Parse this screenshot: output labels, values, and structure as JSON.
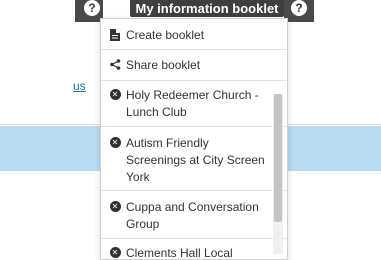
{
  "header": {
    "booklet_tab_label": "My information booklet",
    "help_left": "?",
    "help_right": "?"
  },
  "background": {
    "link_fragment": "us"
  },
  "menu": {
    "actions": [
      {
        "label": "Create booklet",
        "icon": "document-icon"
      },
      {
        "label": "Share booklet",
        "icon": "share-icon"
      }
    ],
    "booklet_items": [
      {
        "label": "Holy Redeemer Church - Lunch Club",
        "icon": "remove-icon"
      },
      {
        "label": "Autism Friendly Screenings at City Screen York",
        "icon": "remove-icon"
      },
      {
        "label": "Cuppa and Conversation Group",
        "icon": "remove-icon"
      },
      {
        "label": "Clements Hall Local",
        "icon": "remove-icon"
      }
    ]
  },
  "colors": {
    "tab_bg": "#3f3f3f",
    "band": "#b9dcf3",
    "link": "#2a6fb5"
  }
}
